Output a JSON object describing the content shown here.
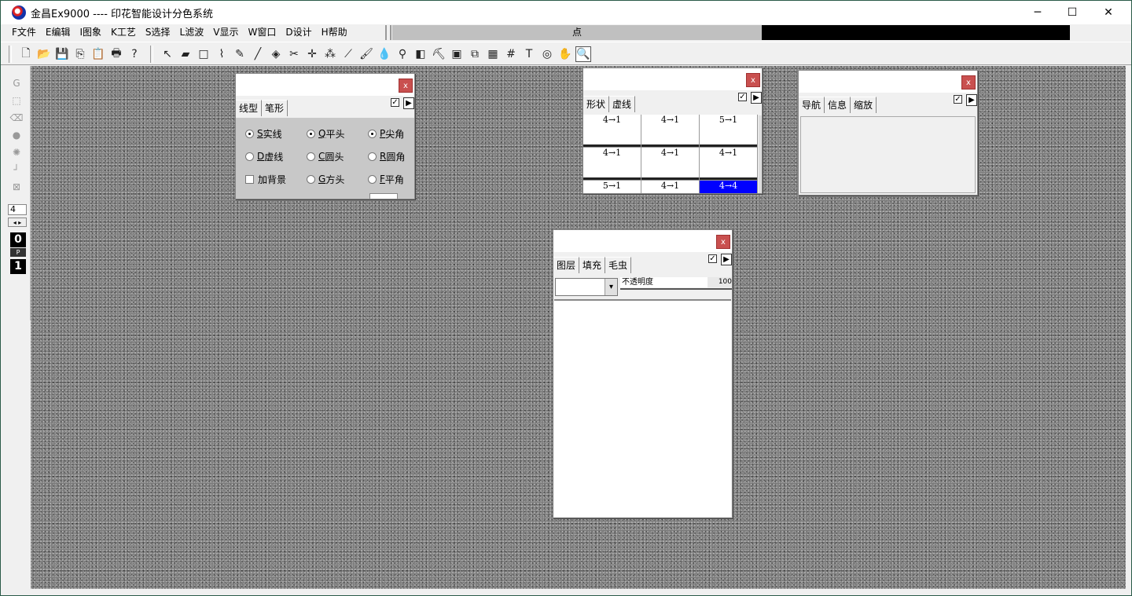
{
  "app": {
    "title": "金昌Ex9000 ---- 印花智能设计分色系统",
    "window_controls": {
      "minimize": "─",
      "maximize": "☐",
      "close": "✕"
    }
  },
  "menu": [
    {
      "label": "F文件"
    },
    {
      "label": "E编辑"
    },
    {
      "label": "I图象"
    },
    {
      "label": "K工艺"
    },
    {
      "label": "S选择"
    },
    {
      "label": "L滤波"
    },
    {
      "label": "V显示"
    },
    {
      "label": "W窗口"
    },
    {
      "label": "D设计"
    },
    {
      "label": "H帮助"
    }
  ],
  "status": {
    "mid_text": "点"
  },
  "toolbar": {
    "file_tools": [
      {
        "name": "new-file-icon",
        "glyph": "🗋"
      },
      {
        "name": "open-folder-icon",
        "glyph": "📂"
      },
      {
        "name": "save-icon",
        "glyph": "💾"
      },
      {
        "name": "copy-icon",
        "glyph": "⎘"
      },
      {
        "name": "paste-icon",
        "glyph": "📋"
      },
      {
        "name": "print-icon",
        "glyph": "🖶"
      },
      {
        "name": "help-icon",
        "glyph": "?"
      }
    ],
    "draw_tools": [
      {
        "name": "select-arrow-icon",
        "glyph": "↖"
      },
      {
        "name": "eraser-icon",
        "glyph": "▰"
      },
      {
        "name": "rectangle-icon",
        "glyph": "□"
      },
      {
        "name": "lasso-icon",
        "glyph": "⌇"
      },
      {
        "name": "pen-icon",
        "glyph": "✎"
      },
      {
        "name": "line-icon",
        "glyph": "╱"
      },
      {
        "name": "fill-bucket-icon",
        "glyph": "◈"
      },
      {
        "name": "scissors-icon",
        "glyph": "✂"
      },
      {
        "name": "color-pick-icon",
        "glyph": "✛"
      },
      {
        "name": "spray-icon",
        "glyph": "⁂"
      },
      {
        "name": "eyedropper-icon",
        "glyph": "⟋"
      },
      {
        "name": "brush-icon",
        "glyph": "🖌"
      },
      {
        "name": "water-drop-icon",
        "glyph": "💧"
      },
      {
        "name": "magnify-small-icon",
        "glyph": "⚲"
      },
      {
        "name": "gradient-icon",
        "glyph": "◧"
      },
      {
        "name": "stamp-icon",
        "glyph": "⛏"
      },
      {
        "name": "frame-icon",
        "glyph": "▣"
      },
      {
        "name": "window-icon",
        "glyph": "⧉"
      },
      {
        "name": "pattern-icon",
        "glyph": "▦"
      },
      {
        "name": "grid-icon",
        "glyph": "#"
      },
      {
        "name": "text-icon",
        "glyph": "T"
      },
      {
        "name": "swirl-icon",
        "glyph": "◎"
      },
      {
        "name": "hand-icon",
        "glyph": "✋"
      },
      {
        "name": "zoom-icon",
        "glyph": "🔍"
      }
    ]
  },
  "left_tools": {
    "items": [
      {
        "name": "g-tool-icon",
        "glyph": "G"
      },
      {
        "name": "marquee-icon",
        "glyph": "⬚"
      },
      {
        "name": "eraser-tool-icon",
        "glyph": "⌫"
      },
      {
        "name": "blob-icon",
        "glyph": "●"
      },
      {
        "name": "sparkle-icon",
        "glyph": "✺"
      },
      {
        "name": "corner-icon",
        "glyph": "┘"
      },
      {
        "name": "crop-icon",
        "glyph": "⊠"
      }
    ],
    "size_value": "4",
    "arrows": "◂ ▸",
    "num_top": "0",
    "p_label": "P",
    "num_bottom": "1"
  },
  "panel_line": {
    "close": "x",
    "tabs": [
      {
        "label": "线型"
      },
      {
        "label": "笔形"
      }
    ],
    "check": "✓",
    "play": "▶",
    "rows": [
      [
        {
          "key": "S",
          "text": "实线",
          "on": true
        },
        {
          "key": "Q",
          "text": "平头",
          "on": true
        },
        {
          "key": "P",
          "text": "尖角",
          "on": true
        }
      ],
      [
        {
          "key": "D",
          "text": "虚线",
          "on": false
        },
        {
          "key": "C",
          "text": "圆头",
          "on": false
        },
        {
          "key": "R",
          "text": "圆角",
          "on": false
        }
      ],
      [
        {
          "key": "",
          "text": "加背景",
          "on": false
        },
        {
          "key": "G",
          "text": "方头",
          "on": false
        },
        {
          "key": "F",
          "text": "平角",
          "on": false
        }
      ]
    ]
  },
  "panel_shape": {
    "close": "x",
    "tabs": [
      {
        "label": "形状"
      },
      {
        "label": "虚线"
      }
    ],
    "check": "✓",
    "play": "▶",
    "cells": [
      "4→1",
      "4→1",
      "5→1",
      "4→1",
      "4→1",
      "4→1",
      "5→1",
      "4→1",
      "4→4"
    ]
  },
  "panel_nav": {
    "close": "x",
    "tabs": [
      {
        "label": "导航"
      },
      {
        "label": "信息"
      },
      {
        "label": "缩放"
      }
    ],
    "check": "✓",
    "play": "▶"
  },
  "panel_layers": {
    "close": "x",
    "tabs": [
      {
        "label": "图层"
      },
      {
        "label": "填充"
      },
      {
        "label": "毛虫"
      }
    ],
    "check": "✓",
    "play": "▶",
    "opacity_label": "不透明度",
    "opacity_value": "100",
    "dropdown_arrow": "▾"
  }
}
